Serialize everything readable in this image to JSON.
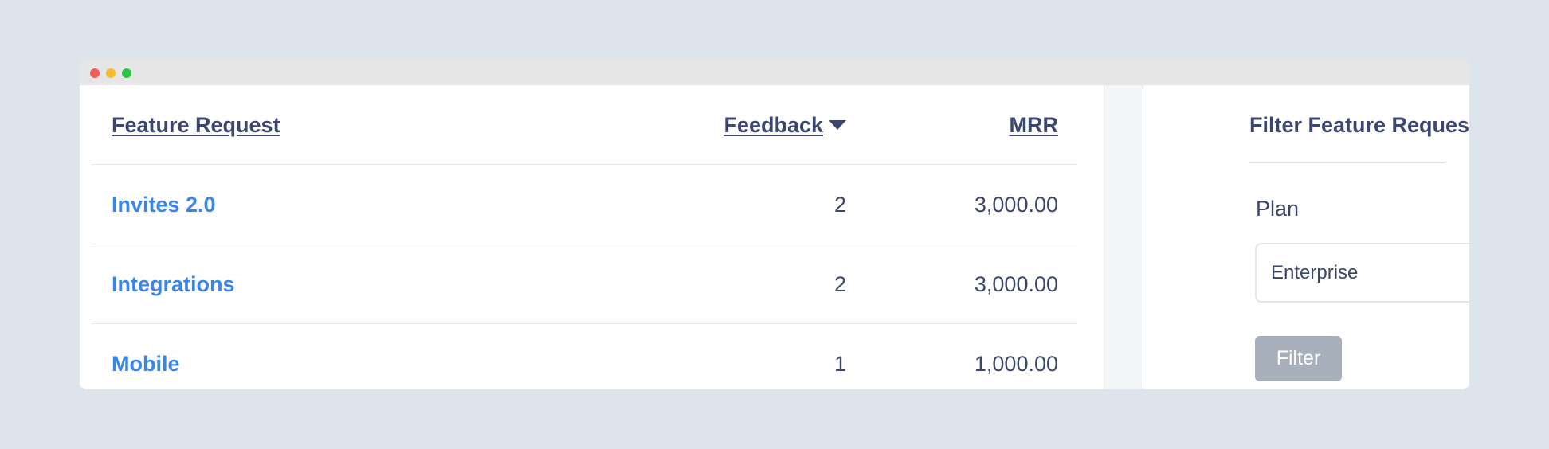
{
  "table": {
    "headers": {
      "feature_request": "Feature Request",
      "feedback": "Feedback",
      "mrr": "MRR"
    },
    "rows": [
      {
        "name": "Invites 2.0",
        "feedback": "2",
        "mrr": "3,000.00"
      },
      {
        "name": "Integrations",
        "feedback": "2",
        "mrr": "3,000.00"
      },
      {
        "name": "Mobile",
        "feedback": "1",
        "mrr": "1,000.00"
      }
    ]
  },
  "sidebar": {
    "title": "Filter Feature Requests",
    "plan_label": "Plan",
    "plan_selected": "Enterprise",
    "filter_button": "Filter"
  },
  "colors": {
    "link": "#3a86e8",
    "heading": "#3c4770",
    "button_disabled": "#a7afba",
    "background": "#dde4ec"
  },
  "icons": {
    "sort": "caret-down-icon",
    "select": "select-arrows-icon"
  }
}
